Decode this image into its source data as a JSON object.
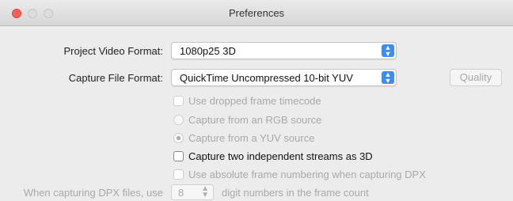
{
  "window": {
    "title": "Preferences"
  },
  "project_video_format": {
    "label": "Project Video Format:",
    "value": "1080p25 3D"
  },
  "capture_file_format": {
    "label": "Capture File Format:",
    "value": "QuickTime Uncompressed 10-bit YUV"
  },
  "quality_button": {
    "label": "Quality",
    "enabled": false
  },
  "options": {
    "dropped_frame_timecode": {
      "label": "Use dropped frame timecode",
      "checked": false,
      "enabled": false
    },
    "capture_rgb": {
      "label": "Capture from an RGB source",
      "selected": false,
      "enabled": false
    },
    "capture_yuv": {
      "label": "Capture from a YUV source",
      "selected": true,
      "enabled": false
    },
    "two_streams_3d": {
      "label": "Capture two independent streams as 3D",
      "checked": false,
      "enabled": true
    },
    "absolute_frame_numbering": {
      "label": "Use absolute frame numbering when capturing DPX",
      "checked": false,
      "enabled": false
    }
  },
  "dpx": {
    "prefix": "When capturing DPX files, use",
    "digits": "8",
    "suffix": "digit numbers in the frame count"
  },
  "colors": {
    "accent": "#3d8cf6",
    "close": "#fc5f57"
  }
}
